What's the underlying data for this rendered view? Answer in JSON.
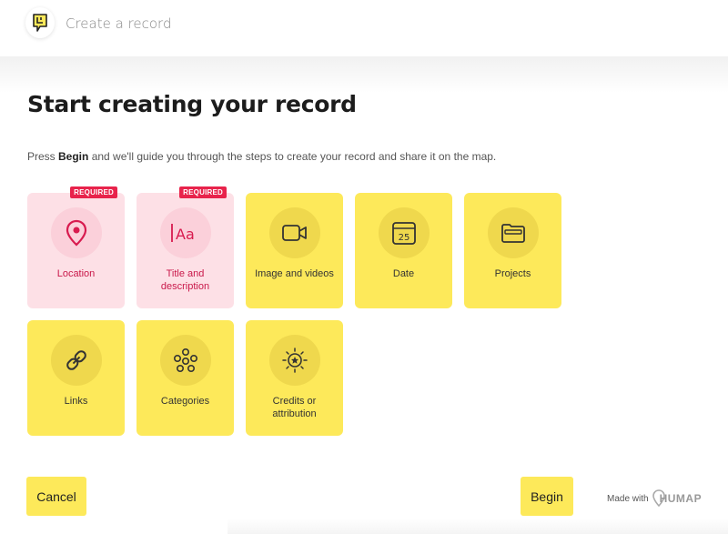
{
  "header": {
    "title": "Create a record"
  },
  "page": {
    "title": "Start creating your record",
    "intro_prefix": "Press ",
    "intro_bold": "Begin",
    "intro_suffix": " and we'll guide you through the steps to create your record and share it on the map."
  },
  "cards": [
    {
      "label": "Location",
      "icon": "map-pin-icon",
      "required": true,
      "badge": "REQUIRED"
    },
    {
      "label": "Title and description",
      "icon": "text-aa-icon",
      "required": true,
      "badge": "REQUIRED"
    },
    {
      "label": "Image and videos",
      "icon": "video-camera-icon",
      "required": false
    },
    {
      "label": "Date",
      "icon": "calendar-icon",
      "required": false,
      "icon_text": "25"
    },
    {
      "label": "Projects",
      "icon": "folder-icon",
      "required": false
    },
    {
      "label": "Links",
      "icon": "link-icon",
      "required": false
    },
    {
      "label": "Categories",
      "icon": "categories-network-icon",
      "required": false
    },
    {
      "label": "Credits or attribution",
      "icon": "star-badge-icon",
      "required": false
    }
  ],
  "footer": {
    "cancel_label": "Cancel",
    "begin_label": "Begin",
    "made_with": "Made with",
    "brand": "HUMAP"
  },
  "colors": {
    "yellow": "#fde95a",
    "pink_bg": "#fde0e6",
    "pink_accent": "#e8234b"
  }
}
